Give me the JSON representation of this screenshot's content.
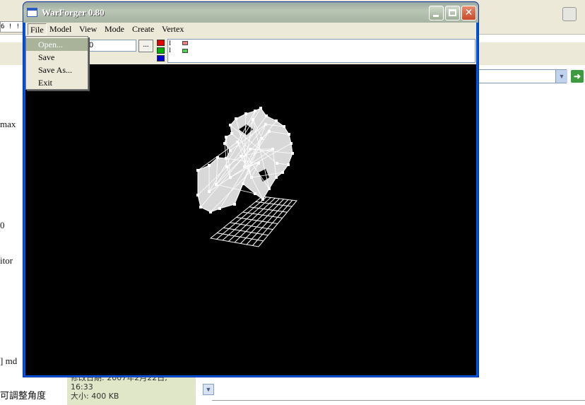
{
  "background": {
    "ruler_text": "6 ! ! ",
    "side_words": [
      "max",
      "0",
      "itor",
      "] md",
      "可調整角度"
    ],
    "info_line1": "修改日期: 2007年2月22日,",
    "info_line2": "16:33",
    "info_line3": "大小: 400 KB"
  },
  "window": {
    "title": "WarForger 0.80",
    "close_glyph": "✕"
  },
  "menu": {
    "file": "File",
    "model": "Model",
    "view": "View",
    "mode": "Mode",
    "create": "Create",
    "vertex": "Vertex"
  },
  "file_menu": {
    "open": "Open...",
    "save": "Save",
    "save_as": "Save As...",
    "exit": "Exit"
  },
  "toolbar": {
    "vertex_value": "0",
    "browse_label": "...",
    "swatch_colors": [
      "#e00000",
      "#00b000",
      "#0000d0"
    ],
    "mini_labels": [
      "I",
      "I"
    ]
  },
  "viewport": {
    "background": "#000000",
    "model_color": "#d8d8d8",
    "grid_color": "#ffffff"
  }
}
